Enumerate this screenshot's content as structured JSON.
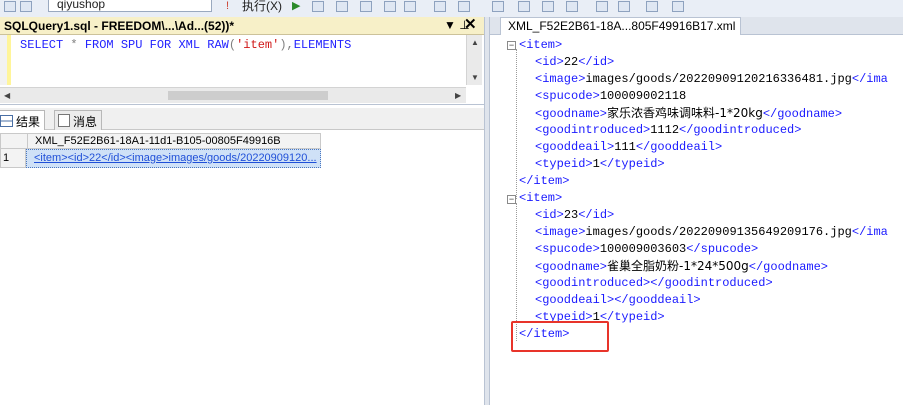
{
  "toolbar": {
    "database": "qiyushop",
    "execute_label": "执行(X)"
  },
  "editor_tab": {
    "title": "SQLQuery1.sql - FREEDOM\\...\\Ad...(52))*",
    "pin": "▼ ⊥",
    "close": "✕"
  },
  "sql": {
    "select": "SELECT",
    "star": "*",
    "from": "FROM",
    "table": "SPU",
    "for": "FOR",
    "xml": "XML",
    "raw": "RAW",
    "open": "(",
    "arg": "'item'",
    "close": ")",
    "comma": ",",
    "elements": "ELEMENTS"
  },
  "results_tabs": {
    "results": "结果",
    "messages": "消息"
  },
  "grid": {
    "column_header": "XML_F52E2B61-18A1-11d1-B105-00805F49916B",
    "row_number": "1",
    "cell_value": "<item><id>22</id><image>images/goods/20220909120..."
  },
  "xml_tab": {
    "title": "XML_F52E2B61-18A...805F49916B17.xml"
  },
  "xml": {
    "items": [
      {
        "open": "<item>",
        "id": "22",
        "image": "images/goods/20220909120216336481.jpg",
        "spucode": "100009002118",
        "goodname": "家乐浓香鸡味调味料-1*20kg",
        "goodintroduced": "1112",
        "gooddeail": "111",
        "typeid": "1",
        "close": "</item>"
      },
      {
        "open": "<item>",
        "id": "23",
        "image": "images/goods/20220909135649209176.jpg",
        "spucode": "100009003603",
        "goodname": "雀巢全脂奶粉-1*24*500g",
        "goodintroduced_empty": "<goodintroduced></goodintroduced>",
        "gooddeail_empty": "<gooddeail></gooddeail>",
        "typeid": "1",
        "close": "</item>"
      }
    ],
    "tags": {
      "id_o": "<id>",
      "id_c": "</id>",
      "image_o": "<image>",
      "image_c": "</ima",
      "spucode_o": "<spucode>",
      "spucode_c": "</spucode>",
      "goodname_o": "<goodname>",
      "goodname_c": "</goodname>",
      "gi_o": "<goodintroduced>",
      "gi_c": "</goodintroduced>",
      "gd_o": "<gooddeail>",
      "gd_c": "</gooddeail>",
      "typeid_o": "<typeid>",
      "typeid_c": "</typeid>"
    },
    "fold_symbol": "−"
  },
  "colors": {
    "highlight": "#e8342a",
    "xml_tag": "#1a1aff",
    "sql_keyword": "#2323ff",
    "sql_string": "#d01818",
    "tab_active": "#f7f0c8"
  }
}
